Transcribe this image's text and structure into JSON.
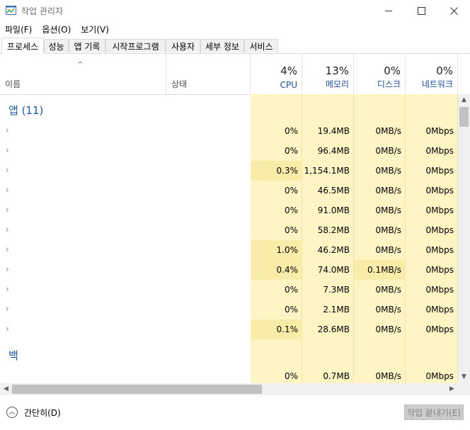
{
  "window": {
    "title": "작업 관리자"
  },
  "menu": [
    "파일(F)",
    "옵션(O)",
    "보기(V)"
  ],
  "tabs": [
    "프로세스",
    "성능",
    "앱 기록",
    "시작프로그램",
    "사용자",
    "세부 정보",
    "서비스"
  ],
  "header": {
    "name": "이름",
    "status": "상태",
    "cpu": {
      "pct": "4%",
      "label": "CPU"
    },
    "memory": {
      "pct": "13%",
      "label": "메모리"
    },
    "disk": {
      "pct": "0%",
      "label": "디스크"
    },
    "network": {
      "pct": "0%",
      "label": "네트워크"
    }
  },
  "groups": {
    "apps": "앱 (11)",
    "background": "백"
  },
  "rows": [
    {
      "cpu": "0%",
      "mem": "19.4MB",
      "disk": "0MB/s",
      "net": "0Mbps"
    },
    {
      "cpu": "0%",
      "mem": "96.4MB",
      "disk": "0MB/s",
      "net": "0Mbps"
    },
    {
      "cpu": "0.3%",
      "mem": "1,154.1MB",
      "disk": "0MB/s",
      "net": "0Mbps"
    },
    {
      "cpu": "0%",
      "mem": "46.5MB",
      "disk": "0MB/s",
      "net": "0Mbps"
    },
    {
      "cpu": "0%",
      "mem": "91.0MB",
      "disk": "0MB/s",
      "net": "0Mbps"
    },
    {
      "cpu": "0%",
      "mem": "58.2MB",
      "disk": "0MB/s",
      "net": "0Mbps"
    },
    {
      "cpu": "1.0%",
      "mem": "46.2MB",
      "disk": "0MB/s",
      "net": "0Mbps"
    },
    {
      "cpu": "0.4%",
      "mem": "74.0MB",
      "disk": "0.1MB/s",
      "net": "0Mbps"
    },
    {
      "cpu": "0%",
      "mem": "7.3MB",
      "disk": "0MB/s",
      "net": "0Mbps"
    },
    {
      "cpu": "0%",
      "mem": "2.1MB",
      "disk": "0MB/s",
      "net": "0Mbps"
    },
    {
      "cpu": "0.1%",
      "mem": "28.6MB",
      "disk": "0MB/s",
      "net": "0Mbps"
    }
  ],
  "background_rows": [
    {
      "cpu": "0%",
      "mem": "0.7MB",
      "disk": "0MB/s",
      "net": "0Mbps"
    }
  ],
  "footer": {
    "fewer_details": "간단히(D)",
    "end_task": "작업 끝내기(E)"
  },
  "colors": {
    "heat_light": "#fff4c4",
    "heat_mid": "#f9eca8",
    "accent": "#1a56b0",
    "button_disabled": "#cccccc"
  }
}
